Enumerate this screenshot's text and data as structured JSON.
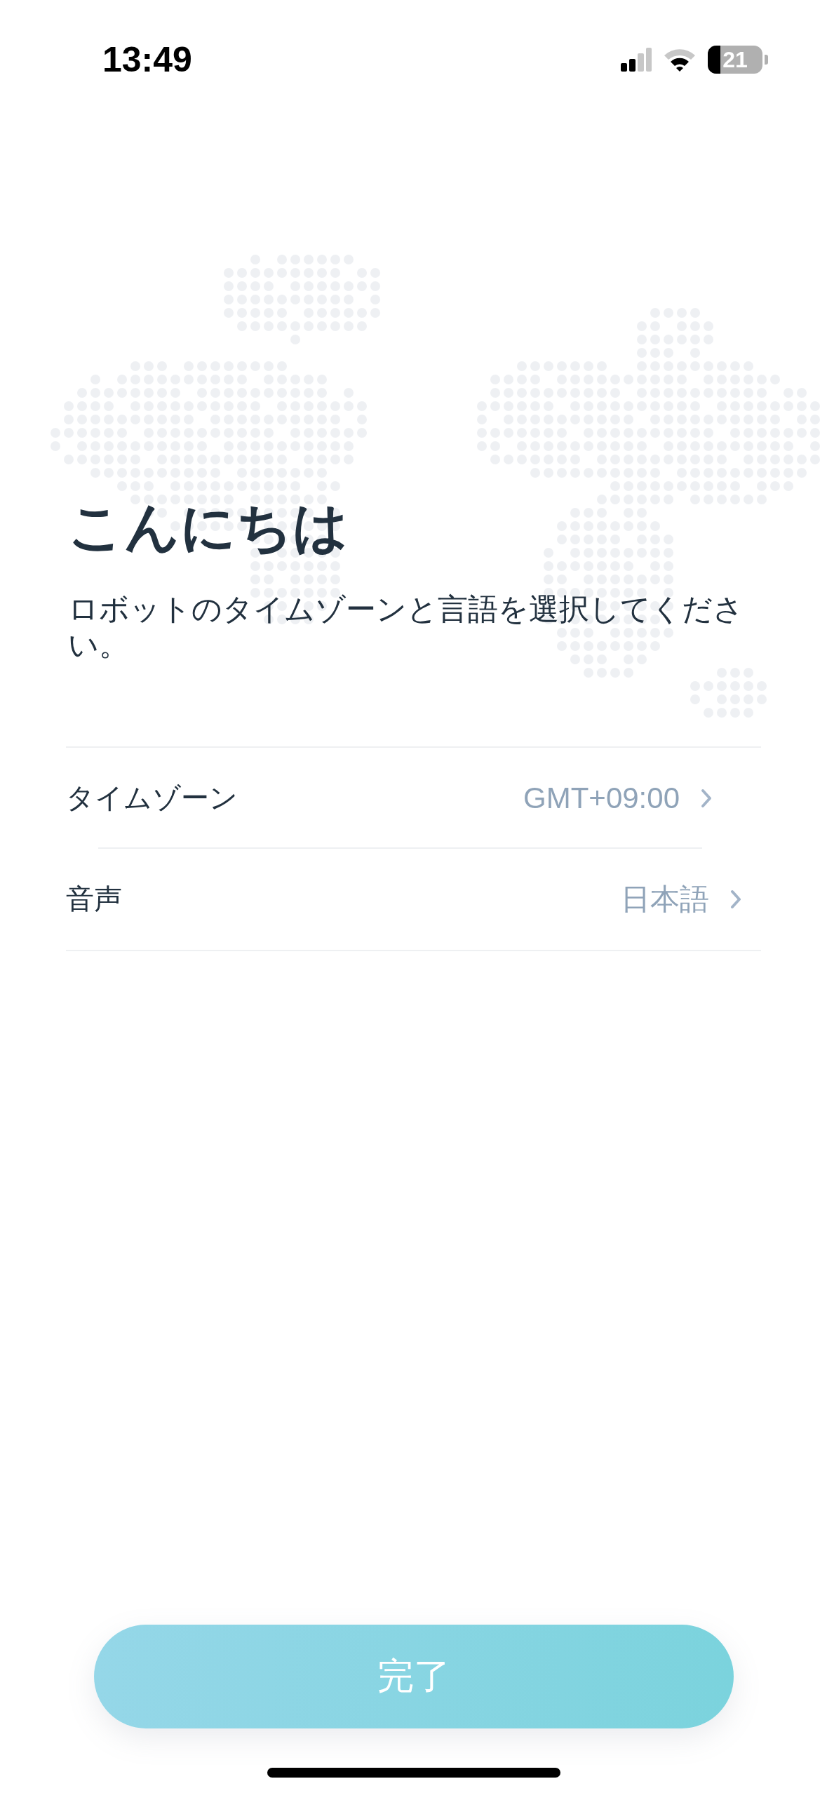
{
  "status_bar": {
    "time": "13:49",
    "battery": "21"
  },
  "greeting": {
    "title": "こんにちは",
    "subtitle": "ロボットのタイムゾーンと言語を選択してください。"
  },
  "settings": [
    {
      "label": "タイムゾーン",
      "value": "GMT+09:00"
    },
    {
      "label": "音声",
      "value": "日本語"
    }
  ],
  "done_button": "完了"
}
